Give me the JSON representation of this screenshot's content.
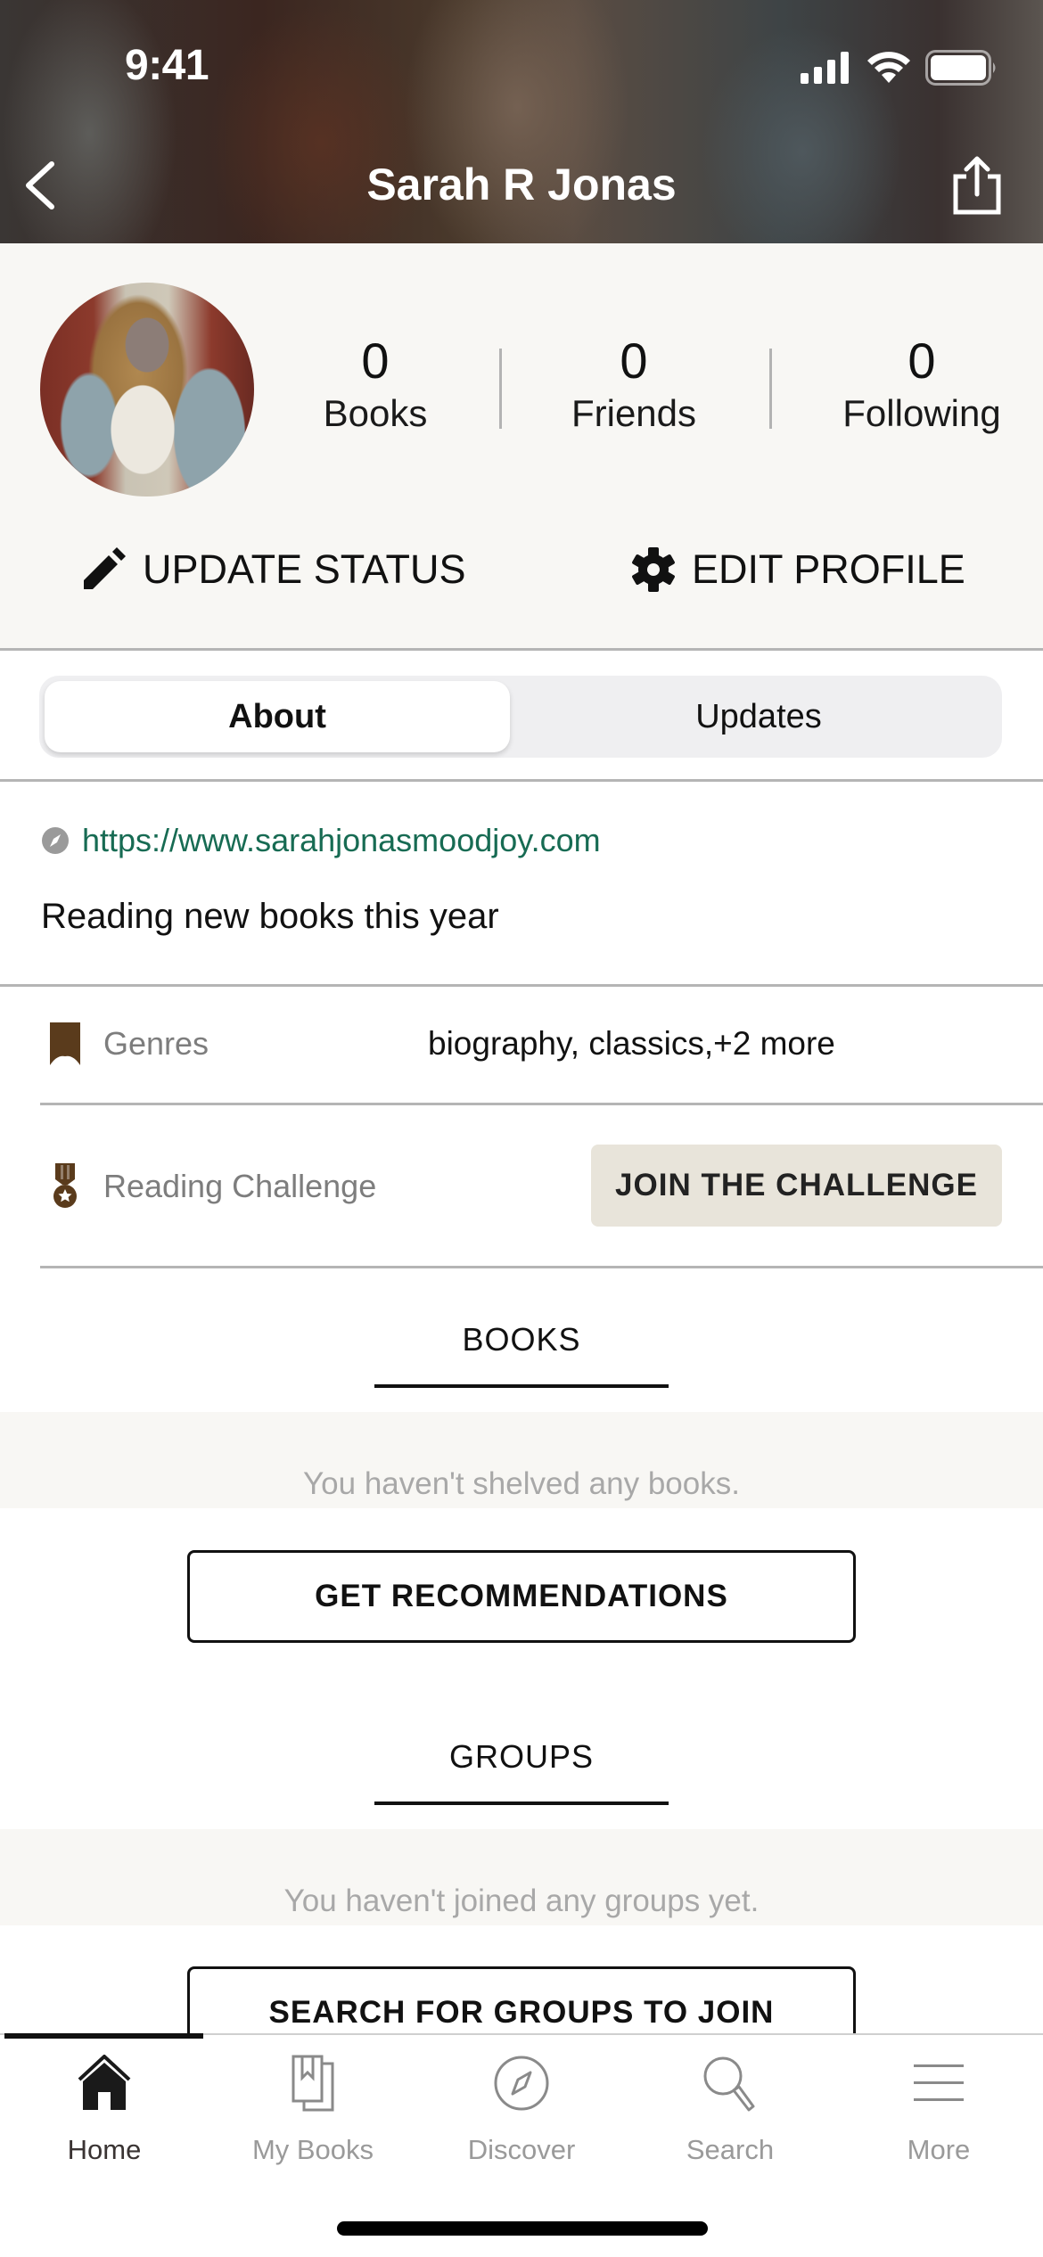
{
  "status_bar": {
    "time": "9:41",
    "icons": [
      "cellular-signal-icon",
      "wifi-icon",
      "battery-icon"
    ]
  },
  "nav": {
    "title": "Sarah R Jonas",
    "back_icon": "chevron-left-icon",
    "share_icon": "share-icon"
  },
  "profile": {
    "avatar_alt": "Profile photo of Sarah R Jonas",
    "stats": [
      {
        "value": "0",
        "label": "Books"
      },
      {
        "value": "0",
        "label": "Friends"
      },
      {
        "value": "0",
        "label": "Following"
      }
    ],
    "actions": {
      "update_status": "UPDATE STATUS",
      "edit_profile": "EDIT PROFILE"
    }
  },
  "segment": {
    "tabs": [
      {
        "label": "About",
        "active": true
      },
      {
        "label": "Updates",
        "active": false
      }
    ]
  },
  "about": {
    "website": "https://www.sarahjonasmoodjoy.com",
    "bio": "Reading new books this year",
    "genres_label": "Genres",
    "genres_value": "biography, classics,+2 more",
    "challenge_label": "Reading Challenge",
    "challenge_button": "JOIN THE CHALLENGE"
  },
  "books": {
    "title": "BOOKS",
    "empty_message": "You haven't shelved any books.",
    "button": "GET RECOMMENDATIONS"
  },
  "groups": {
    "title": "GROUPS",
    "empty_message": "You haven't joined any groups yet.",
    "button": "SEARCH FOR GROUPS TO JOIN"
  },
  "tabbar": {
    "items": [
      {
        "label": "Home",
        "icon": "home-icon",
        "active": true
      },
      {
        "label": "My Books",
        "icon": "my-books-icon",
        "active": false
      },
      {
        "label": "Discover",
        "icon": "compass-icon",
        "active": false
      },
      {
        "label": "Search",
        "icon": "search-icon",
        "active": false
      },
      {
        "label": "More",
        "icon": "menu-icon",
        "active": false
      }
    ]
  },
  "colors": {
    "link": "#176b53",
    "accent_brown": "#5a3b1c",
    "challenge_button_bg": "#e8e4da",
    "profile_bg": "#f8f7f4"
  }
}
